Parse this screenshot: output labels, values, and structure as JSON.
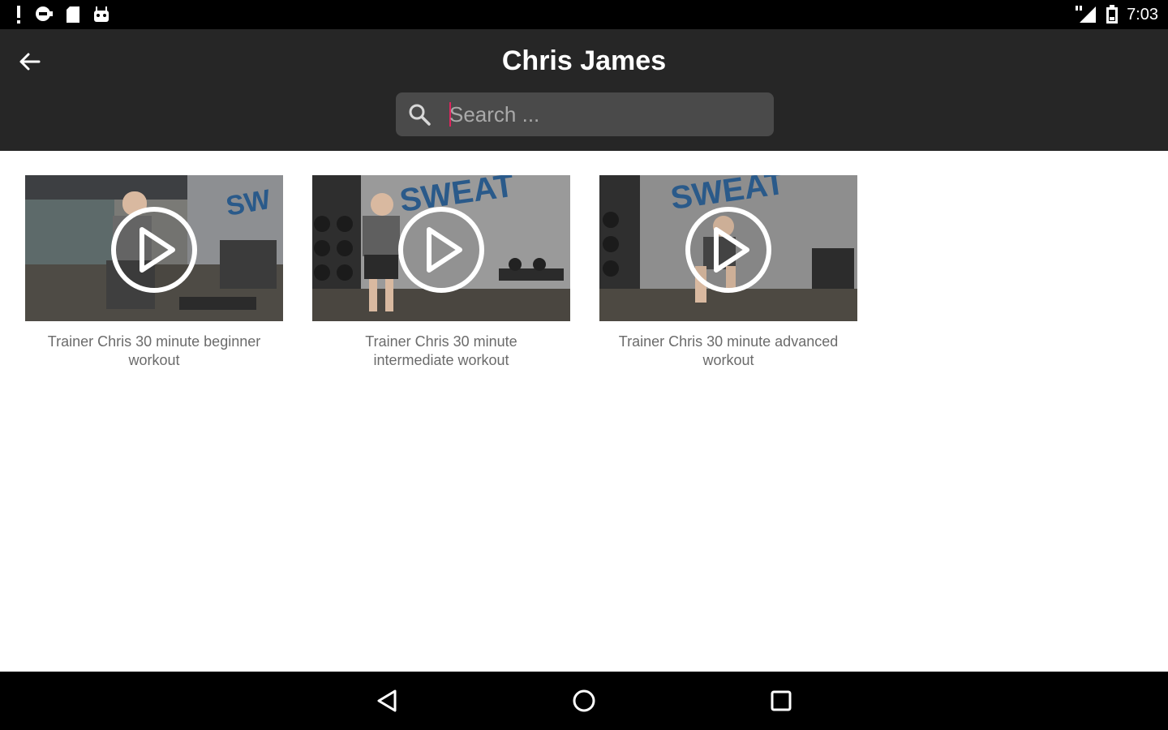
{
  "status_bar": {
    "icons": [
      "alert-icon",
      "chat-icon",
      "sd-card-icon",
      "android-icon"
    ],
    "right_icons": [
      "lte-signal-icon",
      "battery-icon"
    ],
    "time": "7:03"
  },
  "header": {
    "title": "Chris James",
    "back_icon": "arrow-left-icon"
  },
  "search": {
    "placeholder": "Search ...",
    "value": ""
  },
  "videos": [
    {
      "caption": "Trainer Chris 30 minute beginner workout",
      "play_icon": "play-circle-icon"
    },
    {
      "caption": "Trainer Chris 30 minute intermediate workout",
      "play_icon": "play-circle-icon"
    },
    {
      "caption": "Trainer Chris 30 minute advanced workout",
      "play_icon": "play-circle-icon"
    }
  ],
  "nav_bar": {
    "icons": [
      "back-triangle-icon",
      "home-circle-icon",
      "recents-square-icon"
    ]
  },
  "colors": {
    "app_bar": "#262626",
    "search_bg": "#4a4a4a",
    "caret": "#e0245e",
    "caption_text": "#6b6b6b"
  }
}
